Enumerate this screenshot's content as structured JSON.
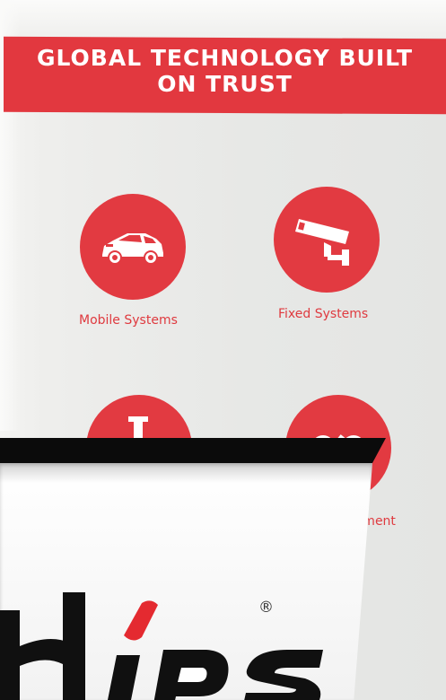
{
  "banner": {
    "headline": "GLOBAL TECHNOLOGY BUILT\nON TRUST",
    "accent_color": "#e23a41"
  },
  "features": [
    {
      "label": "Mobile Systems",
      "icon": "car-icon"
    },
    {
      "label": "Fixed Systems",
      "icon": "security-camera-icon"
    },
    {
      "label": "",
      "icon": "partial-icon"
    },
    {
      "label": "cement",
      "icon": "partial-icon"
    }
  ],
  "product_box": {
    "registered_mark": "®"
  }
}
